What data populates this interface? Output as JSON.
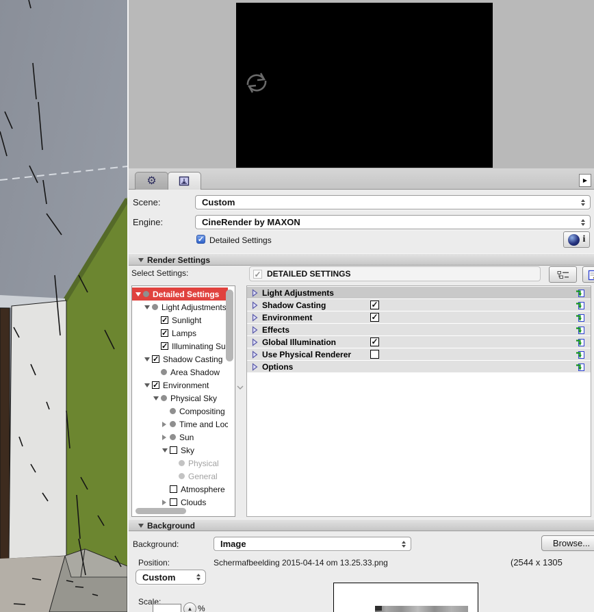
{
  "colors": {
    "accent_red": "#e0423e",
    "wall_green": "#6c8630",
    "row_bg": "#e1e1e1",
    "row_selected_bg": "#c9c9c9",
    "check_blue": "#2f62c8",
    "import_icon_green": "#14941c",
    "import_icon_blue": "#2b3fd0"
  },
  "icons": {
    "gear": "⚙",
    "overflow_arrow": "▶",
    "check": "✓",
    "scale_stepper": "▲"
  },
  "form": {
    "scene_label": "Scene:",
    "scene_value": "Custom",
    "engine_label": "Engine:",
    "engine_value": "CineRender by MAXON",
    "detailed_settings_label": "Detailed Settings",
    "detailed_settings_checked": "✓",
    "info_label": "i"
  },
  "render_settings": {
    "title": "Render Settings",
    "select_settings_label": "Select Settings:",
    "tree": [
      {
        "label": "Detailed Settings",
        "indent": 0,
        "disclosure": "open",
        "control": "bullet",
        "selected": true
      },
      {
        "label": "Light Adjustments",
        "indent": 1,
        "disclosure": "open",
        "control": "bullet"
      },
      {
        "label": "Sunlight",
        "indent": 2,
        "disclosure": "none",
        "control": "checked"
      },
      {
        "label": "Lamps",
        "indent": 2,
        "disclosure": "none",
        "control": "checked"
      },
      {
        "label": "Illuminating Surfaces",
        "indent": 2,
        "disclosure": "none",
        "control": "checked"
      },
      {
        "label": "Shadow Casting",
        "indent": 1,
        "disclosure": "open",
        "control": "checked"
      },
      {
        "label": "Area Shadow",
        "indent": 2,
        "disclosure": "none",
        "control": "bullet"
      },
      {
        "label": "Environment",
        "indent": 1,
        "disclosure": "open",
        "control": "checked"
      },
      {
        "label": "Physical Sky",
        "indent": 2,
        "disclosure": "open",
        "control": "bullet"
      },
      {
        "label": "Compositing",
        "indent": 3,
        "disclosure": "none",
        "control": "bullet"
      },
      {
        "label": "Time and Location",
        "indent": 3,
        "disclosure": "closed",
        "control": "bullet"
      },
      {
        "label": "Sun",
        "indent": 3,
        "disclosure": "closed",
        "control": "bullet"
      },
      {
        "label": "Sky",
        "indent": 3,
        "disclosure": "open",
        "control": "unchecked"
      },
      {
        "label": "Physical",
        "indent": 4,
        "disclosure": "none",
        "control": "bullet",
        "dimmed": true
      },
      {
        "label": "General",
        "indent": 4,
        "disclosure": "none",
        "control": "bullet",
        "dimmed": true
      },
      {
        "label": "Atmosphere",
        "indent": 3,
        "disclosure": "none",
        "control": "unchecked"
      },
      {
        "label": "Clouds",
        "indent": 3,
        "disclosure": "closed",
        "control": "unchecked"
      }
    ],
    "detail_header": "DETAILED SETTINGS",
    "rows": [
      {
        "label": "Light Adjustments",
        "checkbox": "none",
        "selected": true
      },
      {
        "label": "Shadow Casting",
        "checkbox": "checked"
      },
      {
        "label": "Environment",
        "checkbox": "checked"
      },
      {
        "label": "Effects",
        "checkbox": "none"
      },
      {
        "label": "Global Illumination",
        "checkbox": "checked"
      },
      {
        "label": "Use Physical Renderer",
        "checkbox": "unchecked"
      },
      {
        "label": "Options",
        "checkbox": "none"
      }
    ]
  },
  "background": {
    "title": "Background",
    "background_label": "Background:",
    "background_value": "Image",
    "browse_label": "Browse...",
    "position_label": "Position:",
    "filename": "Schermafbeelding 2015-04-14 om 13.25.33.png",
    "image_size": "(2544 x 1305",
    "position_mode_value": "Custom",
    "scale_label": "Scale:",
    "scale_unit": "%"
  }
}
